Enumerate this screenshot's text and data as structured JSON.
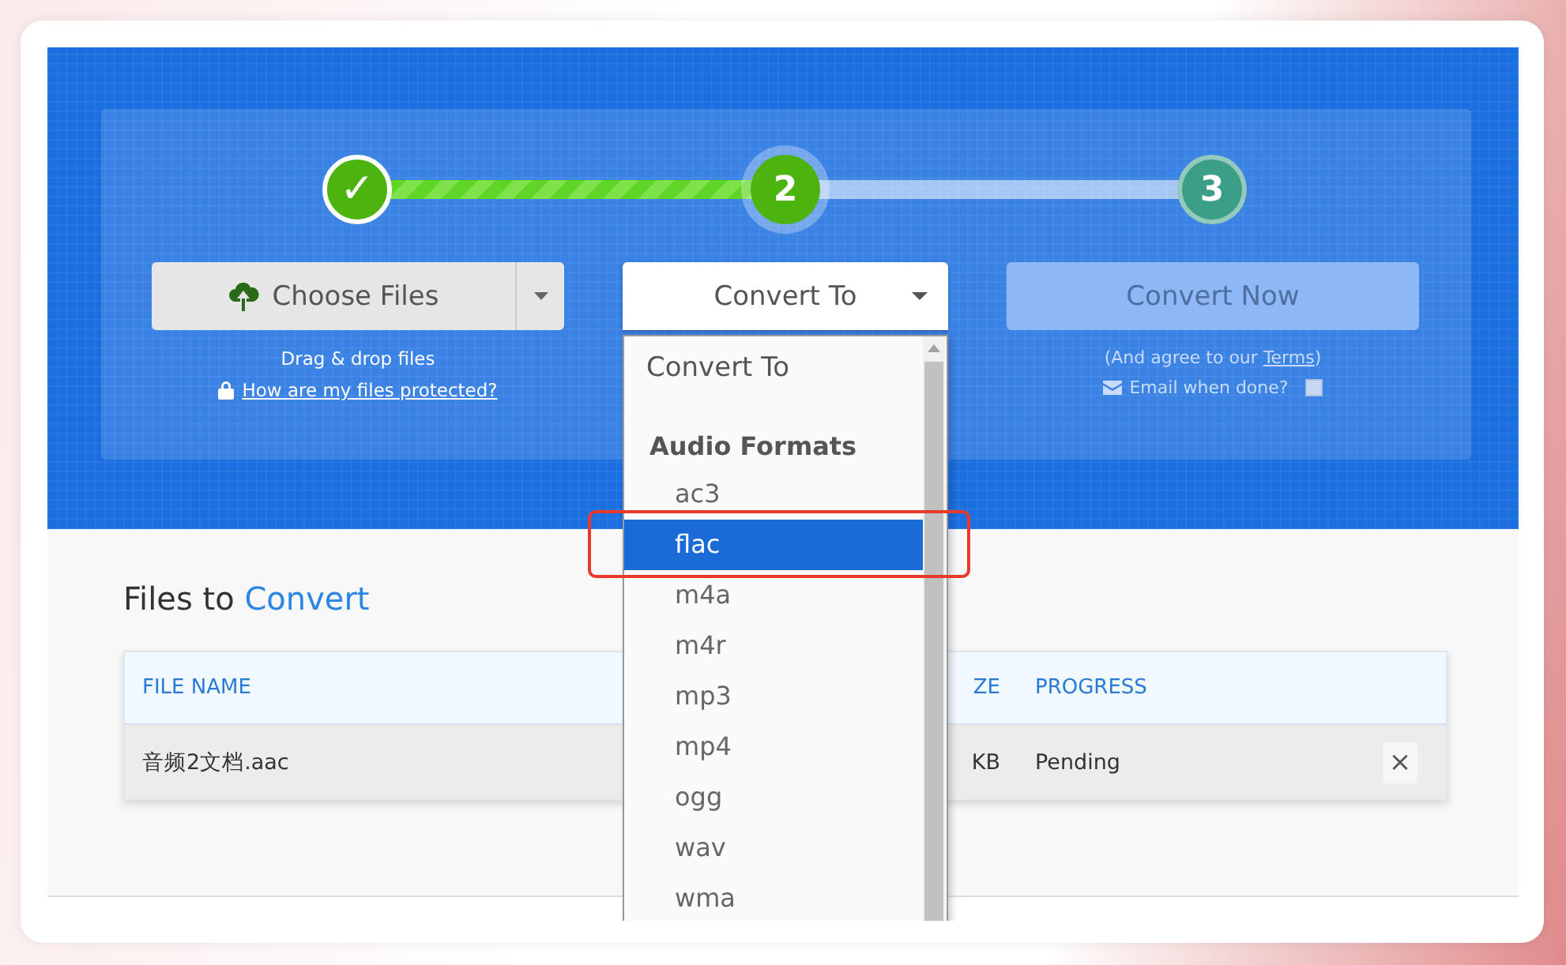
{
  "steps": [
    {
      "label": "✓",
      "done": true,
      "current": false
    },
    {
      "label": "2",
      "done": false,
      "current": true
    },
    {
      "label": "3",
      "done": false,
      "current": false
    }
  ],
  "choose_button": {
    "label": "Choose Files"
  },
  "drag_hint": "Drag & drop files",
  "protect_link": "How are my files protected?",
  "convert_select": {
    "label": "Convert To",
    "expanded": true
  },
  "convert_now": {
    "label": "Convert Now",
    "disabled": true
  },
  "terms": {
    "before": "(And agree to our ",
    "link": "Terms",
    "after": ")"
  },
  "email_option": {
    "label": "Email when done?",
    "checked": false
  },
  "dropdown": {
    "options": [
      {
        "kind": "option",
        "label": "Convert To",
        "selected": false
      },
      {
        "kind": "group",
        "label": "Audio Formats"
      },
      {
        "kind": "option",
        "label": "ac3",
        "selected": false
      },
      {
        "kind": "option",
        "label": "flac",
        "selected": true
      },
      {
        "kind": "option",
        "label": "m4a",
        "selected": false
      },
      {
        "kind": "option",
        "label": "m4r",
        "selected": false
      },
      {
        "kind": "option",
        "label": "mp3",
        "selected": false
      },
      {
        "kind": "option",
        "label": "mp4",
        "selected": false
      },
      {
        "kind": "option",
        "label": "ogg",
        "selected": false
      },
      {
        "kind": "option",
        "label": "wav",
        "selected": false
      },
      {
        "kind": "option",
        "label": "wma",
        "selected": false
      }
    ]
  },
  "files_section": {
    "title": "Files to ",
    "title_accent": "Convert"
  },
  "table": {
    "columns": [
      "FILE NAME",
      "ZE",
      "PROGRESS"
    ],
    "rows": [
      {
        "cells": [
          "音频2文档.aac",
          "KB",
          "Pending"
        ],
        "remove": "×"
      }
    ]
  }
}
